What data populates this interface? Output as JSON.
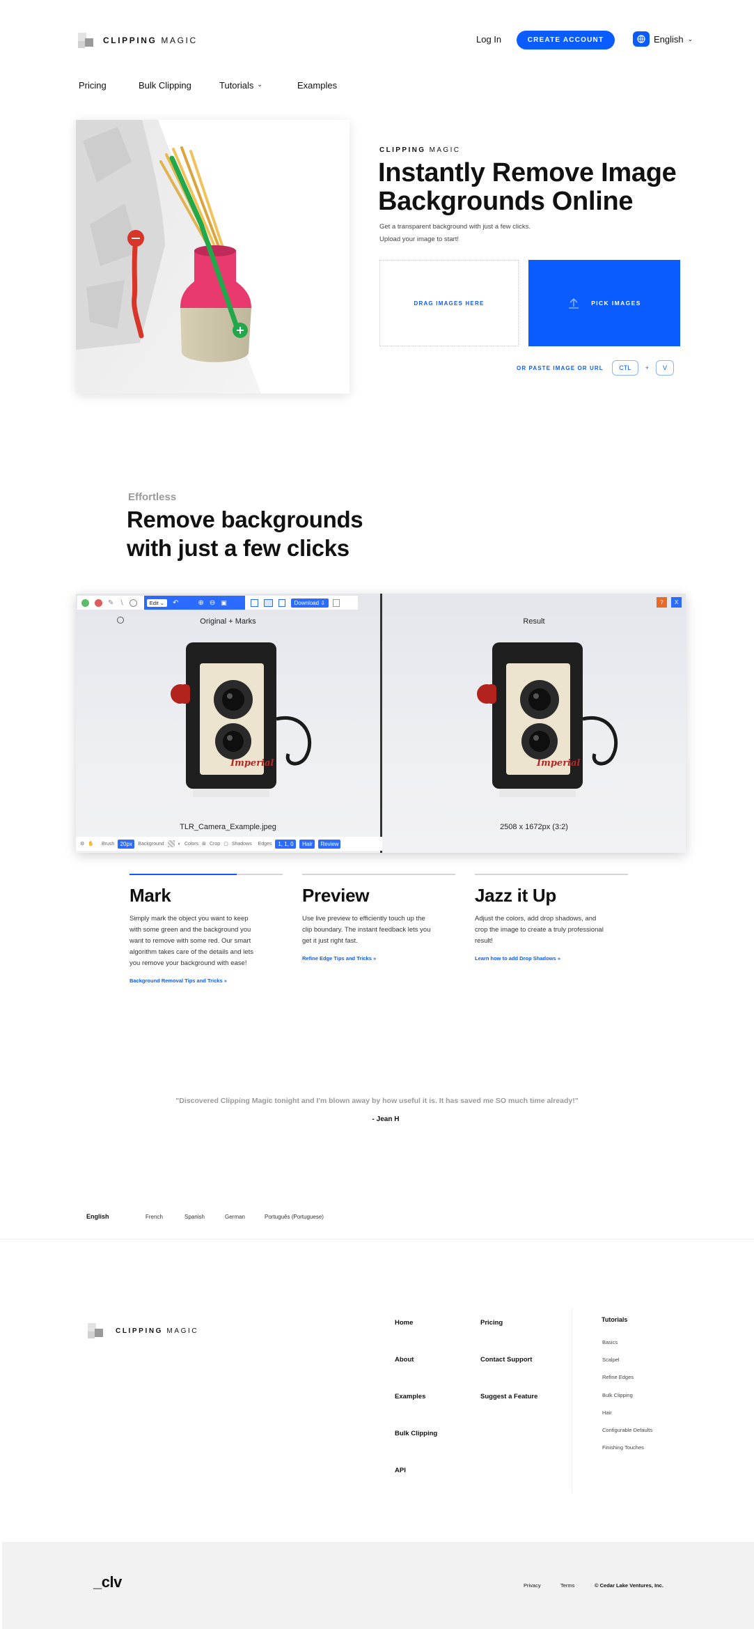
{
  "header": {
    "logo_bold": "CLIPPING",
    "logo_light": "MAGIC",
    "login": "Log In",
    "create_account": "CREATE ACCOUNT",
    "language": "English"
  },
  "nav": {
    "pricing": "Pricing",
    "bulk": "Bulk Clipping",
    "tutorials": "Tutorials",
    "examples": "Examples"
  },
  "hero": {
    "eyebrow_bold": "CLIPPING",
    "eyebrow_light": "MAGIC",
    "title_line1": "Instantly Remove Image",
    "title_line2": "Backgrounds Online",
    "sub1": "Get a transparent background with just a few clicks.",
    "sub2": "Upload your image to start!",
    "drag": "DRAG IMAGES HERE",
    "pick": "PICK IMAGES",
    "paste": "OR PASTE IMAGE OR URL",
    "key_ctl": "CTL",
    "key_plus": "+",
    "key_v": "V"
  },
  "section2": {
    "eyebrow": "Effortless",
    "title_line1": "Remove backgrounds",
    "title_line2": "with just a few clicks"
  },
  "app": {
    "edit": "Edit",
    "download": "Download",
    "help": "?",
    "close": "X",
    "label_left": "Original + Marks",
    "label_right": "Result",
    "filename": "TLR_Camera_Example.jpeg",
    "dimensions": "2508 x 1672px (3:2)",
    "brush_label": "Brush",
    "brush_value": "20px",
    "background_label": "Background",
    "colors": "Colors",
    "crop": "Crop",
    "shadows": "Shadows",
    "edges_label": "Edges",
    "edges_value": "1, 1, 0",
    "hair": "Hair",
    "review": "Review",
    "camera_brand": "Imperial"
  },
  "features": [
    {
      "title": "Mark",
      "lines": [
        "Simply mark the object you want to keep",
        "with some green and the background you",
        "want to remove with some red. Our smart",
        "algorithm takes care of the details and lets",
        "you remove your background with ease!"
      ],
      "link": "Background Removal Tips and Tricks »"
    },
    {
      "title": "Preview",
      "lines": [
        "Use live preview to efficiently touch up the",
        "clip boundary. The instant feedback lets you",
        "get it just right fast."
      ],
      "link": "Refine Edge Tips and Tricks »"
    },
    {
      "title": "Jazz it Up",
      "lines": [
        "Adjust the colors, add drop shadows, and",
        "crop the image to create a truly professional",
        "result!"
      ],
      "link": "Learn how to add Drop Shadows »"
    }
  ],
  "testimonial": {
    "quote": "\"Discovered Clipping Magic tonight and I'm blown away by how useful it is. It has saved me SO much time already!\"",
    "author": "- Jean H"
  },
  "languages": [
    "English",
    "French",
    "Spanish",
    "German",
    "Português (Portuguese)"
  ],
  "footer": {
    "logo_bold": "CLIPPING",
    "logo_light": "MAGIC",
    "col1": [
      "Home",
      "About",
      "Examples",
      "Bulk Clipping",
      "API"
    ],
    "col2": [
      "Pricing",
      "Contact Support",
      "Suggest a Feature"
    ],
    "tutorials_title": "Tutorials",
    "tutorials": [
      "Basics",
      "Scalpel",
      "Refine Edges",
      "Bulk Clipping",
      "Hair",
      "Configurable Defaults",
      "Finishing Touches"
    ]
  },
  "bottom": {
    "brand": "_clv",
    "privacy": "Privacy",
    "terms": "Terms",
    "copyright": "© Cedar Lake Ventures, Inc."
  },
  "colors": {
    "accent": "#0a5cff",
    "red_mark": "#d8352a",
    "green_mark": "#22a84b"
  }
}
